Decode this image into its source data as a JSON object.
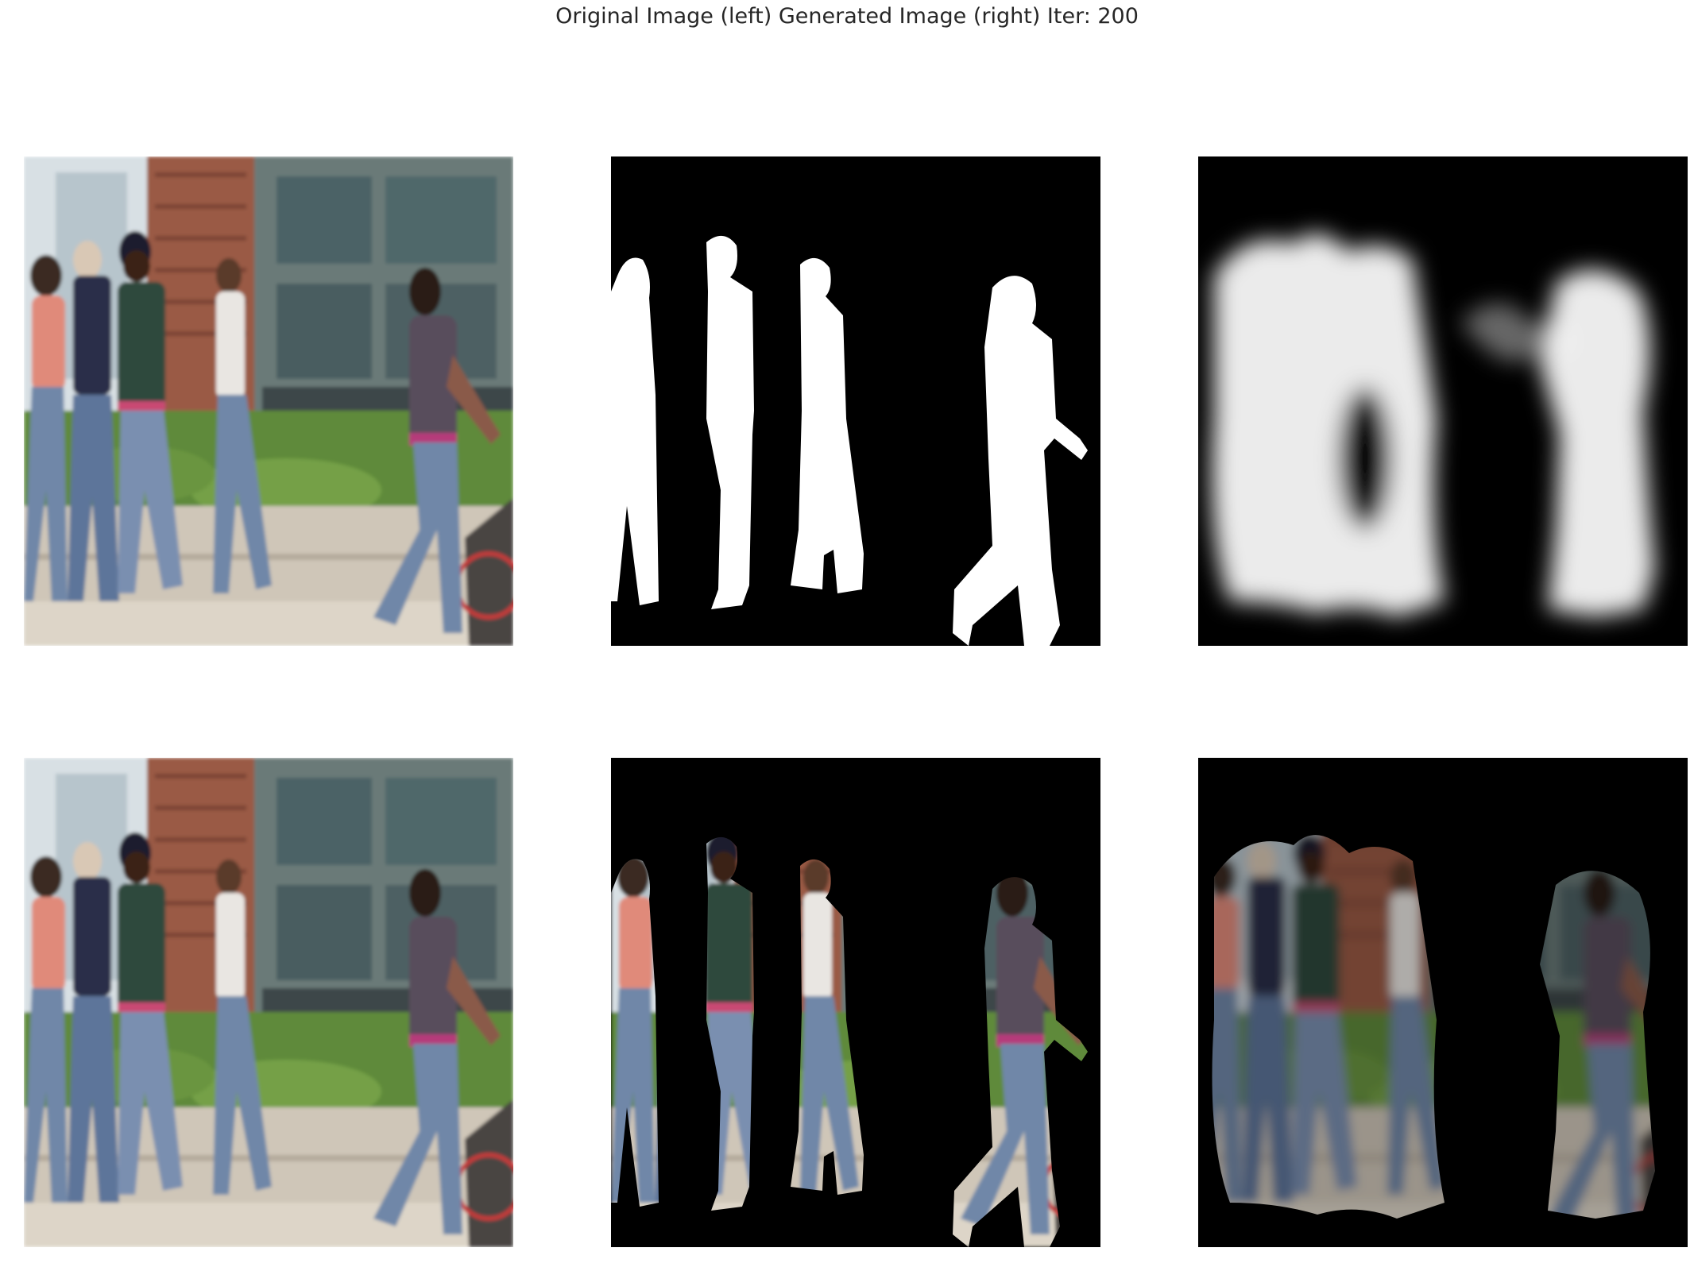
{
  "figure": {
    "title": "Original Image (left) Generated Image (right) Iter: 200"
  },
  "panels": [
    {
      "row": 1,
      "column": 1,
      "kind": "original-photo"
    },
    {
      "row": 1,
      "column": 2,
      "kind": "ground-truth-mask"
    },
    {
      "row": 1,
      "column": 3,
      "kind": "predicted-mask"
    },
    {
      "row": 2,
      "column": 1,
      "kind": "original-photo"
    },
    {
      "row": 2,
      "column": 2,
      "kind": "masked-photo-ground-truth"
    },
    {
      "row": 2,
      "column": 3,
      "kind": "masked-photo-predicted"
    }
  ],
  "colors": {
    "brick": "#9a5a45",
    "window_glass": "#4c6266",
    "wall": "#c9d3d8",
    "grass": "#5f8a3a",
    "pavement": "#cfc6b8",
    "jeans": "#6f87a8",
    "jacket_green": "#2f4a3c",
    "top_pink": "#e08a7a",
    "mask_white": "#ffffff",
    "background_black": "#000000"
  }
}
